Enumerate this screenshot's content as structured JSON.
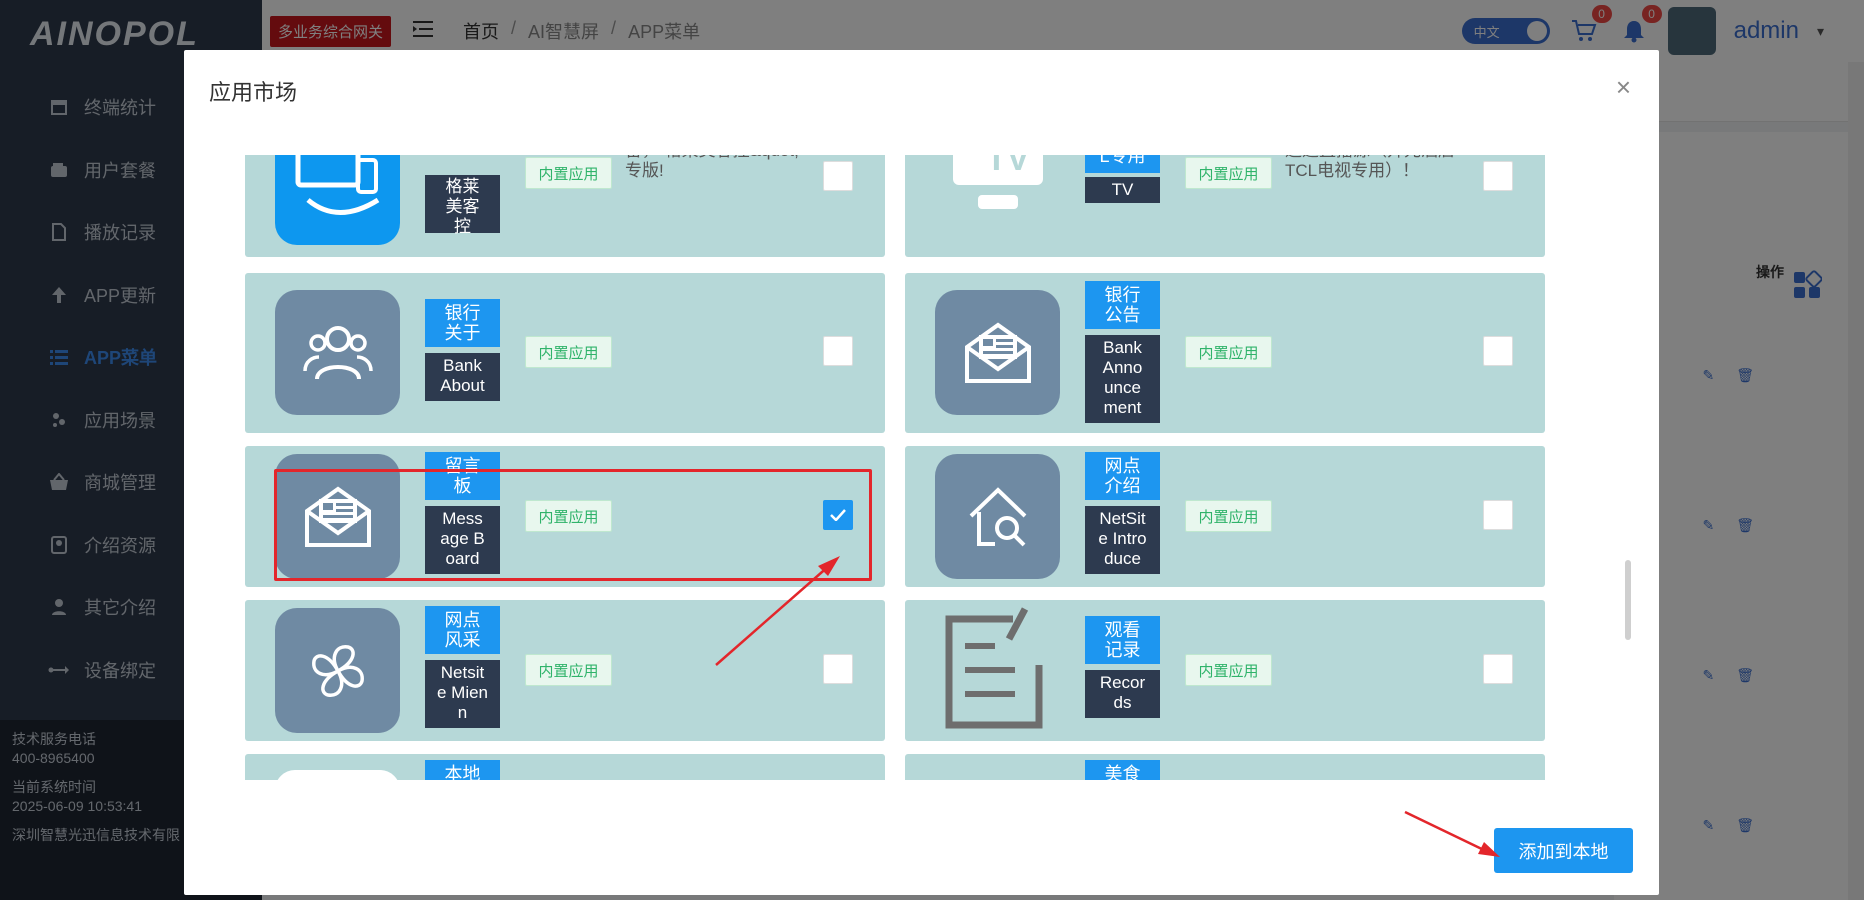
{
  "sidebar": {
    "logo": "AINOPOL",
    "items": [
      {
        "label": "终端统计",
        "icon": "calendar-icon"
      },
      {
        "label": "用户套餐",
        "icon": "wallet-icon"
      },
      {
        "label": "播放记录",
        "icon": "document-icon"
      },
      {
        "label": "APP更新",
        "icon": "arrow-up-icon"
      },
      {
        "label": "APP菜单",
        "icon": "list-icon"
      },
      {
        "label": "应用场景",
        "icon": "scene-icon"
      },
      {
        "label": "商城管理",
        "icon": "basket-icon"
      },
      {
        "label": "介绍资源",
        "icon": "contact-icon"
      },
      {
        "label": "其它介绍",
        "icon": "user-icon"
      },
      {
        "label": "设备绑定",
        "icon": "usb-icon"
      }
    ],
    "footer": {
      "phone_label": "技术服务电话",
      "phone": "400-8965400",
      "time_label": "当前系统时间",
      "time": "2025-06-09 10:53:41",
      "company": "深圳智慧光迅信息技术有限"
    }
  },
  "header": {
    "tag": "多业务综合网关",
    "breadcrumb": [
      "首页",
      "AI智慧屏",
      "APP菜单"
    ],
    "lang": "中文",
    "cart_count": "0",
    "bell_count": "0",
    "user": "admin"
  },
  "background": {
    "op_header": "操作"
  },
  "modal": {
    "title": "应用市场",
    "add_button": "添加到本地",
    "builtin_label": "内置应用",
    "cards": [
      {
        "cn": "格莱美客控",
        "cn_top": "控",
        "en": "格莱美客控",
        "desc": "电视端控制客房智控设备，“格莱美客控&quot;专版!",
        "icon": "tv-phone-icon",
        "checked": false
      },
      {
        "cn": "视TCL专用",
        "cn_top": "视TC L专用",
        "en": "TV",
        "desc": "对接TCL电视数字接口通道直播源（开元酒店TCL电视专用）！",
        "icon": "tv-icon",
        "checked": false
      },
      {
        "cn": "银行关于",
        "en": "Bank About",
        "desc": "",
        "icon": "users-icon",
        "checked": false
      },
      {
        "cn": "银行公告",
        "en": "Bank Announcement",
        "desc": "",
        "icon": "envelope-icon",
        "checked": false
      },
      {
        "cn": "留言板",
        "en": "Message Board",
        "desc": "",
        "icon": "envelope-icon",
        "checked": true
      },
      {
        "cn": "网点介绍",
        "en": "NetSite Introduce",
        "desc": "",
        "icon": "home-search-icon",
        "checked": false
      },
      {
        "cn": "网点风采",
        "en": "Netsite Mien",
        "desc": "",
        "icon": "petals-icon",
        "checked": false
      },
      {
        "cn": "观看记录",
        "en": "Records",
        "desc": "",
        "icon": "edit-note-icon",
        "checked": false
      },
      {
        "cn": "本地",
        "en": "",
        "desc": "",
        "icon": "blank-icon",
        "checked": false
      },
      {
        "cn": "美食",
        "en": "",
        "desc": "",
        "icon": "blank-icon",
        "checked": false
      }
    ]
  }
}
